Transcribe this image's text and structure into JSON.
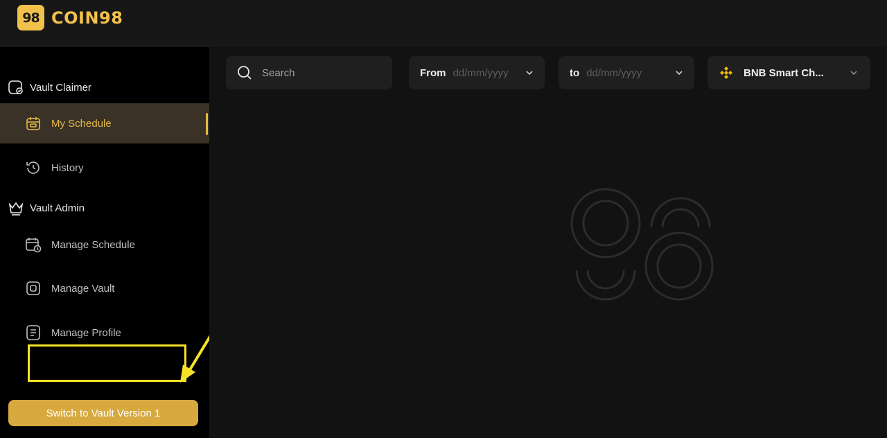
{
  "brand": {
    "name": "COIN98",
    "badge": "98",
    "accent": "#f2c14b"
  },
  "sidebar": {
    "groups": [
      {
        "title": "Vault Claimer",
        "icon": "vault-claimer-icon"
      },
      {
        "title": "Vault Admin",
        "icon": "crown-icon"
      }
    ],
    "items": [
      {
        "label": "My Schedule",
        "icon": "calendar-icon",
        "active": true
      },
      {
        "label": "History",
        "icon": "history-icon"
      },
      {
        "label": "Manage Schedule",
        "icon": "calendar-clock-icon"
      },
      {
        "label": "Manage Vault",
        "icon": "vault-icon"
      },
      {
        "label": "Manage Profile",
        "icon": "document-icon"
      }
    ],
    "switch_button": "Switch to Vault Version 1"
  },
  "filters": {
    "search_placeholder": "Search",
    "from_label": "From",
    "from_placeholder": "dd/mm/yyyy",
    "to_label": "to",
    "to_placeholder": "dd/mm/yyyy",
    "network": "BNB Smart Ch..."
  }
}
